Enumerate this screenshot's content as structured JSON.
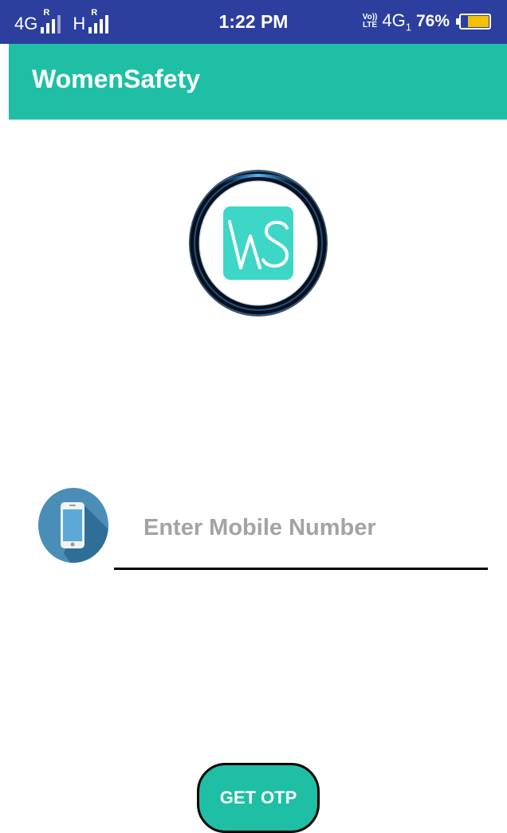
{
  "status_bar": {
    "network1": "4G",
    "network2": "H",
    "roaming_marker": "R",
    "time": "1:22 PM",
    "volte_top": "Vo))",
    "volte_bottom": "LTE",
    "network3": "4G",
    "network3_sub": "1",
    "battery_percent": "76%",
    "battery_level": 0.76,
    "battery_color": "#f5c000",
    "bg_color": "#2c3e9e",
    "icons": [
      "signal-icon",
      "signal-icon",
      "battery-icon"
    ]
  },
  "app_bar": {
    "title": "WomenSafety",
    "bg_color": "#1ebfa5"
  },
  "logo": {
    "icon": "ws-logo-icon",
    "accent_color": "#3ed6c6"
  },
  "login": {
    "phone_icon": "mobile-phone-icon",
    "mobile_placeholder": "Enter Mobile Number",
    "mobile_value": "",
    "otp_button_label": "GET OTP"
  }
}
